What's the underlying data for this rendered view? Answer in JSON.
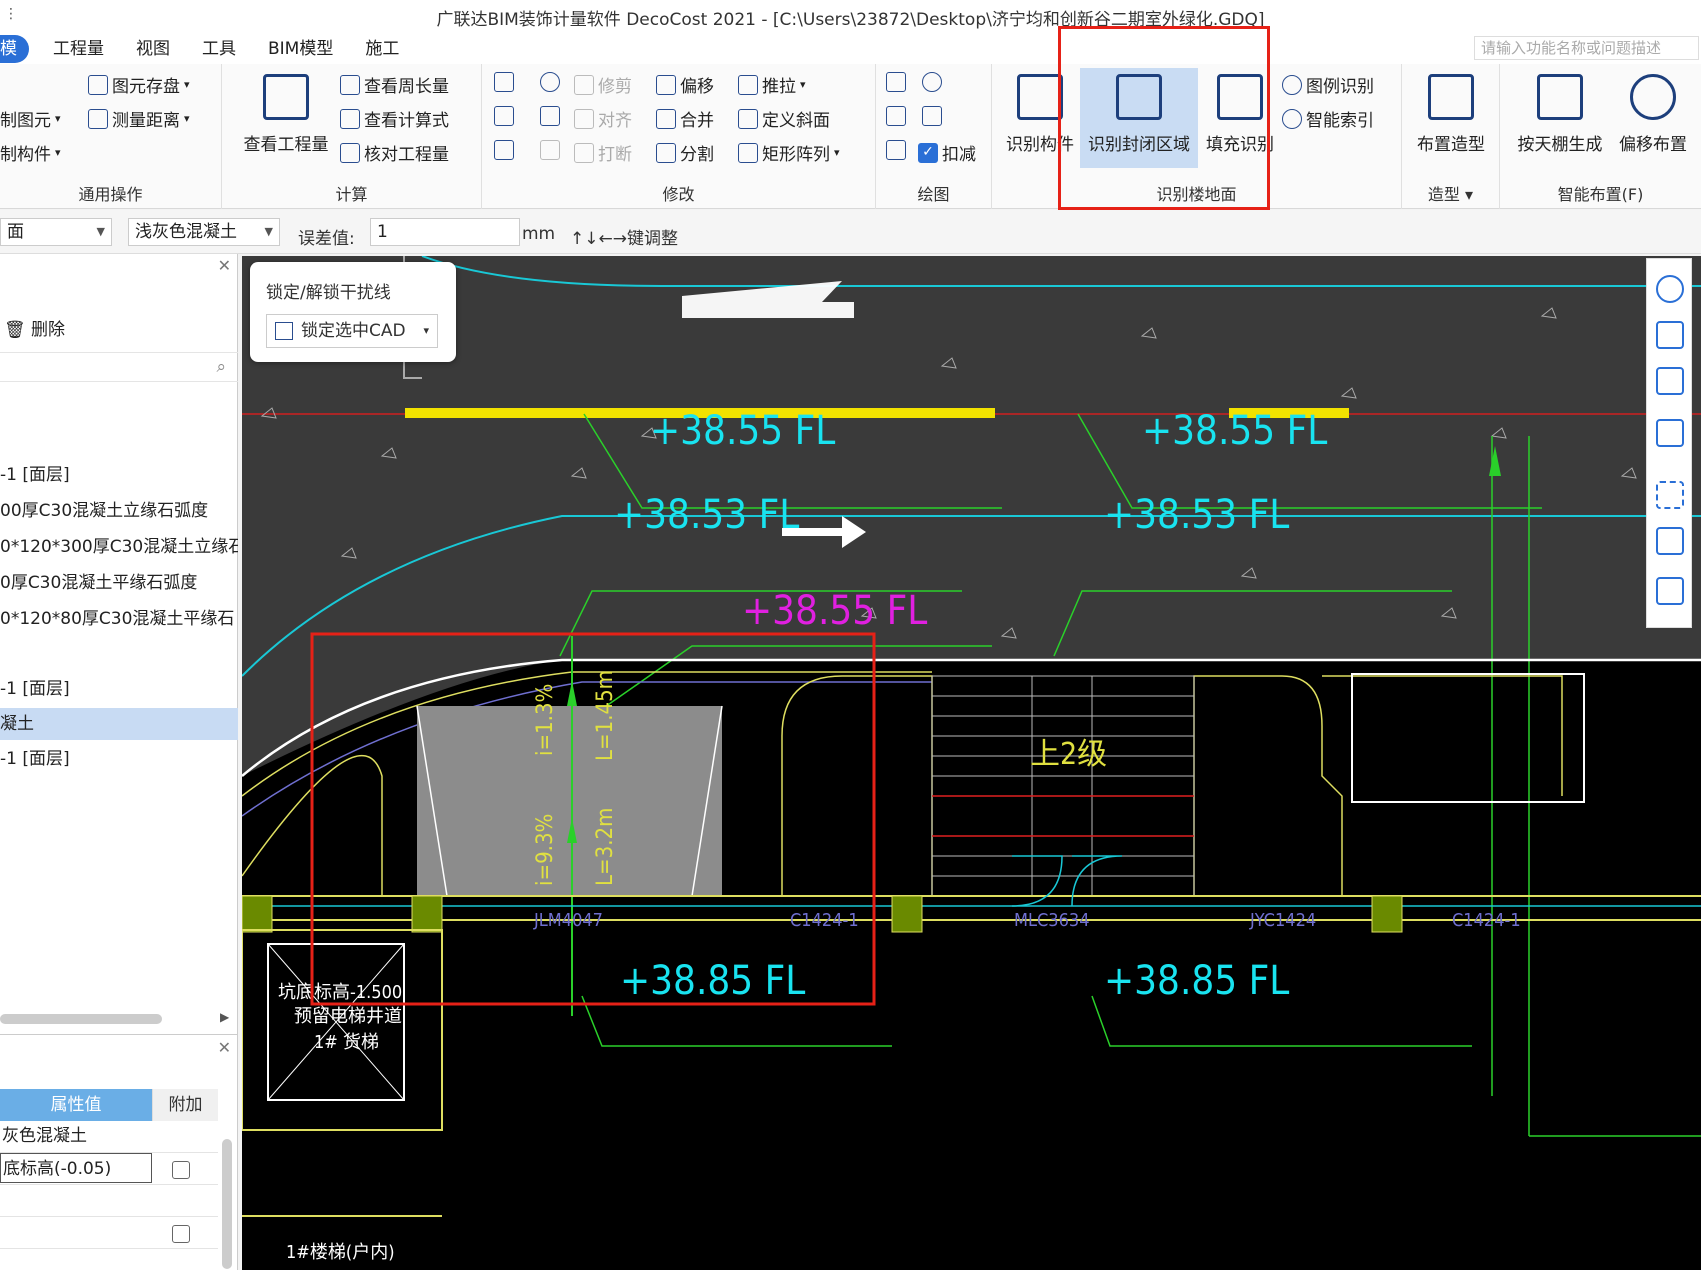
{
  "window": {
    "title": "广联达BIM装饰计量软件 DecoCost 2021 - [C:\\Users\\23872\\Desktop\\济宁均和创新谷二期室外绿化.GDQ]",
    "quick_access": "⋮"
  },
  "menu": {
    "items": [
      "模",
      "工程量",
      "视图",
      "工具",
      "BIM模型",
      "施工"
    ],
    "search_placeholder": "请输入功能名称或问题描述"
  },
  "ribbon": {
    "general": {
      "title": "通用操作",
      "btn_store": "图元存盘",
      "btn_copy_elem": "制图元",
      "btn_measure": "测量距离",
      "btn_copy_comp": "制构件"
    },
    "calc": {
      "title": "计算",
      "btn_view_qty": "查看工程量",
      "btn_perimeter": "查看周长量",
      "btn_formula": "查看计算式",
      "btn_check": "核对工程量"
    },
    "modify": {
      "title": "修改",
      "btn_trim": "修剪",
      "btn_offset": "偏移",
      "btn_push": "推拉",
      "btn_align": "对齐",
      "btn_merge": "合并",
      "btn_slope": "定义斜面",
      "btn_break": "打断",
      "btn_split": "分割",
      "btn_array": "矩形阵列"
    },
    "draw": {
      "title": "绘图",
      "btn_deduct": "扣减"
    },
    "recognize": {
      "title": "识别楼地面",
      "btn_component": "识别构件",
      "btn_closed": "识别封闭区域",
      "btn_fill": "填充识别",
      "btn_legend": "图例识别",
      "btn_index": "智能索引"
    },
    "shape": {
      "title": "造型",
      "btn_layout": "布置造型"
    },
    "smart": {
      "title": "智能布置(F)",
      "btn_ceiling": "按天棚生成",
      "btn_offset_layout": "偏移布置"
    }
  },
  "propbar": {
    "combo1": "面",
    "combo2": "浅灰色混凝土",
    "tolerance_label": "误差值:",
    "tolerance_value": "1",
    "unit": "mm",
    "hint": "↑↓←→键调整"
  },
  "leftpanel": {
    "delete_label": "删除",
    "tree": [
      "-1 [面层]",
      "00厚C30混凝土立缘石弧度",
      "0*120*300厚C30混凝土立缘石",
      "0厚C30混凝土平缘石弧度",
      "0*120*80厚C30混凝土平缘石",
      "-1 [面层]",
      "凝土",
      "-1 [面层]"
    ],
    "props": {
      "col_value": "属性值",
      "col_extra": "附加",
      "rows": [
        "灰色混凝土",
        "底标高(-0.05)"
      ]
    }
  },
  "lock_popup": {
    "title": "锁定/解锁干扰线",
    "button": "锁定选中CAD"
  },
  "cad": {
    "elev_top_1": "+38.55 FL",
    "elev_top_2": "+38.55 FL",
    "elev_mid_1": "+38.53 FL",
    "elev_mid_2": "+38.53 FL",
    "elev_magenta": "+38.55 FL",
    "elev_bot_1": "+38.85 FL",
    "elev_bot_2": "+38.85 FL",
    "slope_1": "i=1.3%",
    "len_1": "L=1.45m",
    "slope_2": "i=9.3%",
    "len_2": "L=3.2m",
    "stair_label": "上2级",
    "door_1": "JLM4047",
    "door_2": "C1424-1",
    "door_3": "MLC3634",
    "door_4": "JYC1424",
    "door_5": "C1424-1",
    "elevator_1": "坑底标高-1.500",
    "elevator_2": "预留电梯井道",
    "elevator_3": "1# 货梯",
    "stair_room": "1#楼梯(户内)"
  }
}
